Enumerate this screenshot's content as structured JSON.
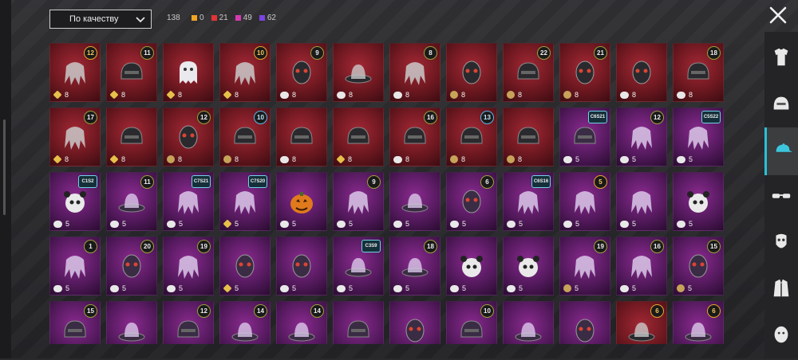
{
  "header": {
    "sort_label": "По качеству",
    "total": "138",
    "counts": [
      {
        "value": "0",
        "color": "#f0a426"
      },
      {
        "value": "21",
        "color": "#e23434"
      },
      {
        "value": "49",
        "color": "#d43ab0"
      },
      {
        "value": "62",
        "color": "#7a44e0"
      }
    ]
  },
  "sidebar": [
    {
      "icon": "shirt-icon"
    },
    {
      "icon": "helmet-icon"
    },
    {
      "icon": "cap-icon",
      "active": true
    },
    {
      "icon": "glasses-icon"
    },
    {
      "icon": "mask-icon"
    },
    {
      "icon": "jacket-icon"
    },
    {
      "icon": "face-icon"
    }
  ],
  "items": [
    {
      "tier": "red",
      "level": "12",
      "badge": "gold",
      "currency": "diamond",
      "qty": "8",
      "art": "hair"
    },
    {
      "tier": "red",
      "level": "11",
      "badge": "olive",
      "currency": "diamond",
      "qty": "8",
      "art": "helmet"
    },
    {
      "tier": "red",
      "level": "",
      "badge": "",
      "currency": "diamond",
      "qty": "8",
      "art": "ghost"
    },
    {
      "tier": "red",
      "level": "10",
      "badge": "gold",
      "currency": "diamond",
      "qty": "8",
      "art": "hair"
    },
    {
      "tier": "red",
      "level": "9",
      "badge": "olive",
      "currency": "cloud",
      "qty": "8",
      "art": "mask"
    },
    {
      "tier": "red",
      "level": "",
      "badge": "",
      "currency": "cloud",
      "qty": "8",
      "art": "hat"
    },
    {
      "tier": "red",
      "level": "8",
      "badge": "olive",
      "currency": "cloud",
      "qty": "8",
      "art": "hair"
    },
    {
      "tier": "red",
      "level": "",
      "badge": "",
      "currency": "coin",
      "qty": "8",
      "art": "mask"
    },
    {
      "tier": "red",
      "level": "22",
      "badge": "olive",
      "currency": "coin",
      "qty": "8",
      "art": "helmet"
    },
    {
      "tier": "red",
      "level": "21",
      "badge": "olive",
      "currency": "coin",
      "qty": "8",
      "art": "mask"
    },
    {
      "tier": "red",
      "level": "",
      "badge": "",
      "currency": "cloud",
      "qty": "8",
      "art": "mask"
    },
    {
      "tier": "red",
      "level": "18",
      "badge": "olive",
      "currency": "cloud",
      "qty": "8",
      "art": "helmet"
    },
    {
      "tier": "red",
      "level": "17",
      "badge": "olive",
      "currency": "diamond",
      "qty": "8",
      "art": "hair"
    },
    {
      "tier": "red",
      "level": "",
      "badge": "",
      "currency": "diamond",
      "qty": "8",
      "art": "helmet"
    },
    {
      "tier": "red",
      "level": "12",
      "badge": "olive",
      "currency": "coin",
      "qty": "8",
      "art": "mask"
    },
    {
      "tier": "red",
      "level": "10",
      "badge": "blue",
      "currency": "coin",
      "qty": "8",
      "art": "helmet"
    },
    {
      "tier": "red",
      "level": "",
      "badge": "",
      "currency": "cloud",
      "qty": "8",
      "art": "helmet"
    },
    {
      "tier": "red",
      "level": "",
      "badge": "",
      "currency": "diamond",
      "qty": "8",
      "art": "helmet"
    },
    {
      "tier": "red",
      "level": "16",
      "badge": "olive",
      "currency": "cloud",
      "qty": "8",
      "art": "helmet"
    },
    {
      "tier": "red",
      "level": "13",
      "badge": "blue",
      "currency": "coin",
      "qty": "8",
      "art": "helmet"
    },
    {
      "tier": "red",
      "level": "",
      "badge": "",
      "currency": "coin",
      "qty": "8",
      "art": "helmet"
    },
    {
      "tier": "purple",
      "level": "C6S21",
      "badge": "hex",
      "currency": "cloud",
      "qty": "5",
      "art": "helmet"
    },
    {
      "tier": "purple",
      "level": "12",
      "badge": "olive",
      "currency": "cloud",
      "qty": "5",
      "art": "hair"
    },
    {
      "tier": "purple",
      "level": "C5S22",
      "badge": "hex",
      "currency": "cloud",
      "qty": "5",
      "art": "hair"
    },
    {
      "tier": "purple",
      "level": "C1S2",
      "badge": "hex",
      "currency": "cloud",
      "qty": "5",
      "art": "animal"
    },
    {
      "tier": "purple",
      "level": "11",
      "badge": "olive",
      "currency": "cloud",
      "qty": "5",
      "art": "hat"
    },
    {
      "tier": "purple",
      "level": "C7S21",
      "badge": "hex",
      "currency": "cloud",
      "qty": "5",
      "art": "hair"
    },
    {
      "tier": "purple",
      "level": "C7S20",
      "badge": "hex",
      "currency": "diamond",
      "qty": "5",
      "art": "hair"
    },
    {
      "tier": "purple",
      "level": "",
      "badge": "",
      "currency": "cloud",
      "qty": "5",
      "art": "pumpkin"
    },
    {
      "tier": "purple",
      "level": "9",
      "badge": "olive",
      "currency": "cloud",
      "qty": "5",
      "art": "hair"
    },
    {
      "tier": "purple",
      "level": "",
      "badge": "",
      "currency": "cloud",
      "qty": "5",
      "art": "hat"
    },
    {
      "tier": "purple",
      "level": "6",
      "badge": "olive",
      "currency": "cloud",
      "qty": "5",
      "art": "mask"
    },
    {
      "tier": "purple",
      "level": "C6S16",
      "badge": "hex",
      "currency": "cloud",
      "qty": "5",
      "art": "hair"
    },
    {
      "tier": "purple",
      "level": "5",
      "badge": "gold",
      "currency": "cloud",
      "qty": "5",
      "art": "hair"
    },
    {
      "tier": "purple",
      "level": "",
      "badge": "",
      "currency": "cloud",
      "qty": "5",
      "art": "hair"
    },
    {
      "tier": "purple",
      "level": "",
      "badge": "",
      "currency": "cloud",
      "qty": "5",
      "art": "animal"
    },
    {
      "tier": "purple",
      "level": "1",
      "badge": "olive",
      "currency": "cloud",
      "qty": "5",
      "art": "hair"
    },
    {
      "tier": "purple",
      "level": "20",
      "badge": "olive",
      "currency": "cloud",
      "qty": "5",
      "art": "mask"
    },
    {
      "tier": "purple",
      "level": "19",
      "badge": "olive",
      "currency": "cloud",
      "qty": "5",
      "art": "hair"
    },
    {
      "tier": "purple",
      "level": "",
      "badge": "",
      "currency": "diamond",
      "qty": "5",
      "art": "mask"
    },
    {
      "tier": "purple",
      "level": "",
      "badge": "",
      "currency": "cloud",
      "qty": "5",
      "art": "mask"
    },
    {
      "tier": "purple",
      "level": "C3S9",
      "badge": "hex",
      "currency": "cloud",
      "qty": "5",
      "art": "hat"
    },
    {
      "tier": "purple",
      "level": "18",
      "badge": "olive",
      "currency": "cloud",
      "qty": "5",
      "art": "hat"
    },
    {
      "tier": "purple",
      "level": "",
      "badge": "",
      "currency": "cloud",
      "qty": "5",
      "art": "animal"
    },
    {
      "tier": "purple",
      "level": "",
      "badge": "",
      "currency": "cloud",
      "qty": "5",
      "art": "animal"
    },
    {
      "tier": "purple",
      "level": "19",
      "badge": "olive",
      "currency": "coin",
      "qty": "5",
      "art": "hair"
    },
    {
      "tier": "purple",
      "level": "16",
      "badge": "olive",
      "currency": "cloud",
      "qty": "5",
      "art": "hair"
    },
    {
      "tier": "purple",
      "level": "15",
      "badge": "olive",
      "currency": "coin",
      "qty": "5",
      "art": "mask"
    },
    {
      "tier": "purple",
      "level": "15",
      "badge": "olive",
      "currency": "",
      "qty": "",
      "art": "helmet"
    },
    {
      "tier": "purple",
      "level": "",
      "badge": "",
      "currency": "",
      "qty": "",
      "art": "hat"
    },
    {
      "tier": "purple",
      "level": "12",
      "badge": "olive",
      "currency": "",
      "qty": "",
      "art": "helmet"
    },
    {
      "tier": "purple",
      "level": "14",
      "badge": "olive",
      "currency": "",
      "qty": "",
      "art": "hat"
    },
    {
      "tier": "purple",
      "level": "14",
      "badge": "olive",
      "currency": "",
      "qty": "",
      "art": "hat"
    },
    {
      "tier": "purple",
      "level": "",
      "badge": "",
      "currency": "",
      "qty": "",
      "art": "helmet"
    },
    {
      "tier": "purple",
      "level": "",
      "badge": "",
      "currency": "",
      "qty": "",
      "art": "mask"
    },
    {
      "tier": "purple",
      "level": "10",
      "badge": "olive",
      "currency": "",
      "qty": "",
      "art": "helmet"
    },
    {
      "tier": "purple",
      "level": "",
      "badge": "",
      "currency": "",
      "qty": "",
      "art": "hat"
    },
    {
      "tier": "purple",
      "level": "",
      "badge": "",
      "currency": "",
      "qty": "",
      "art": "mask"
    },
    {
      "tier": "red",
      "level": "6",
      "badge": "gold",
      "currency": "",
      "qty": "",
      "art": "hat"
    },
    {
      "tier": "purple",
      "level": "6",
      "badge": "gold",
      "currency": "",
      "qty": "",
      "art": "hat"
    }
  ]
}
